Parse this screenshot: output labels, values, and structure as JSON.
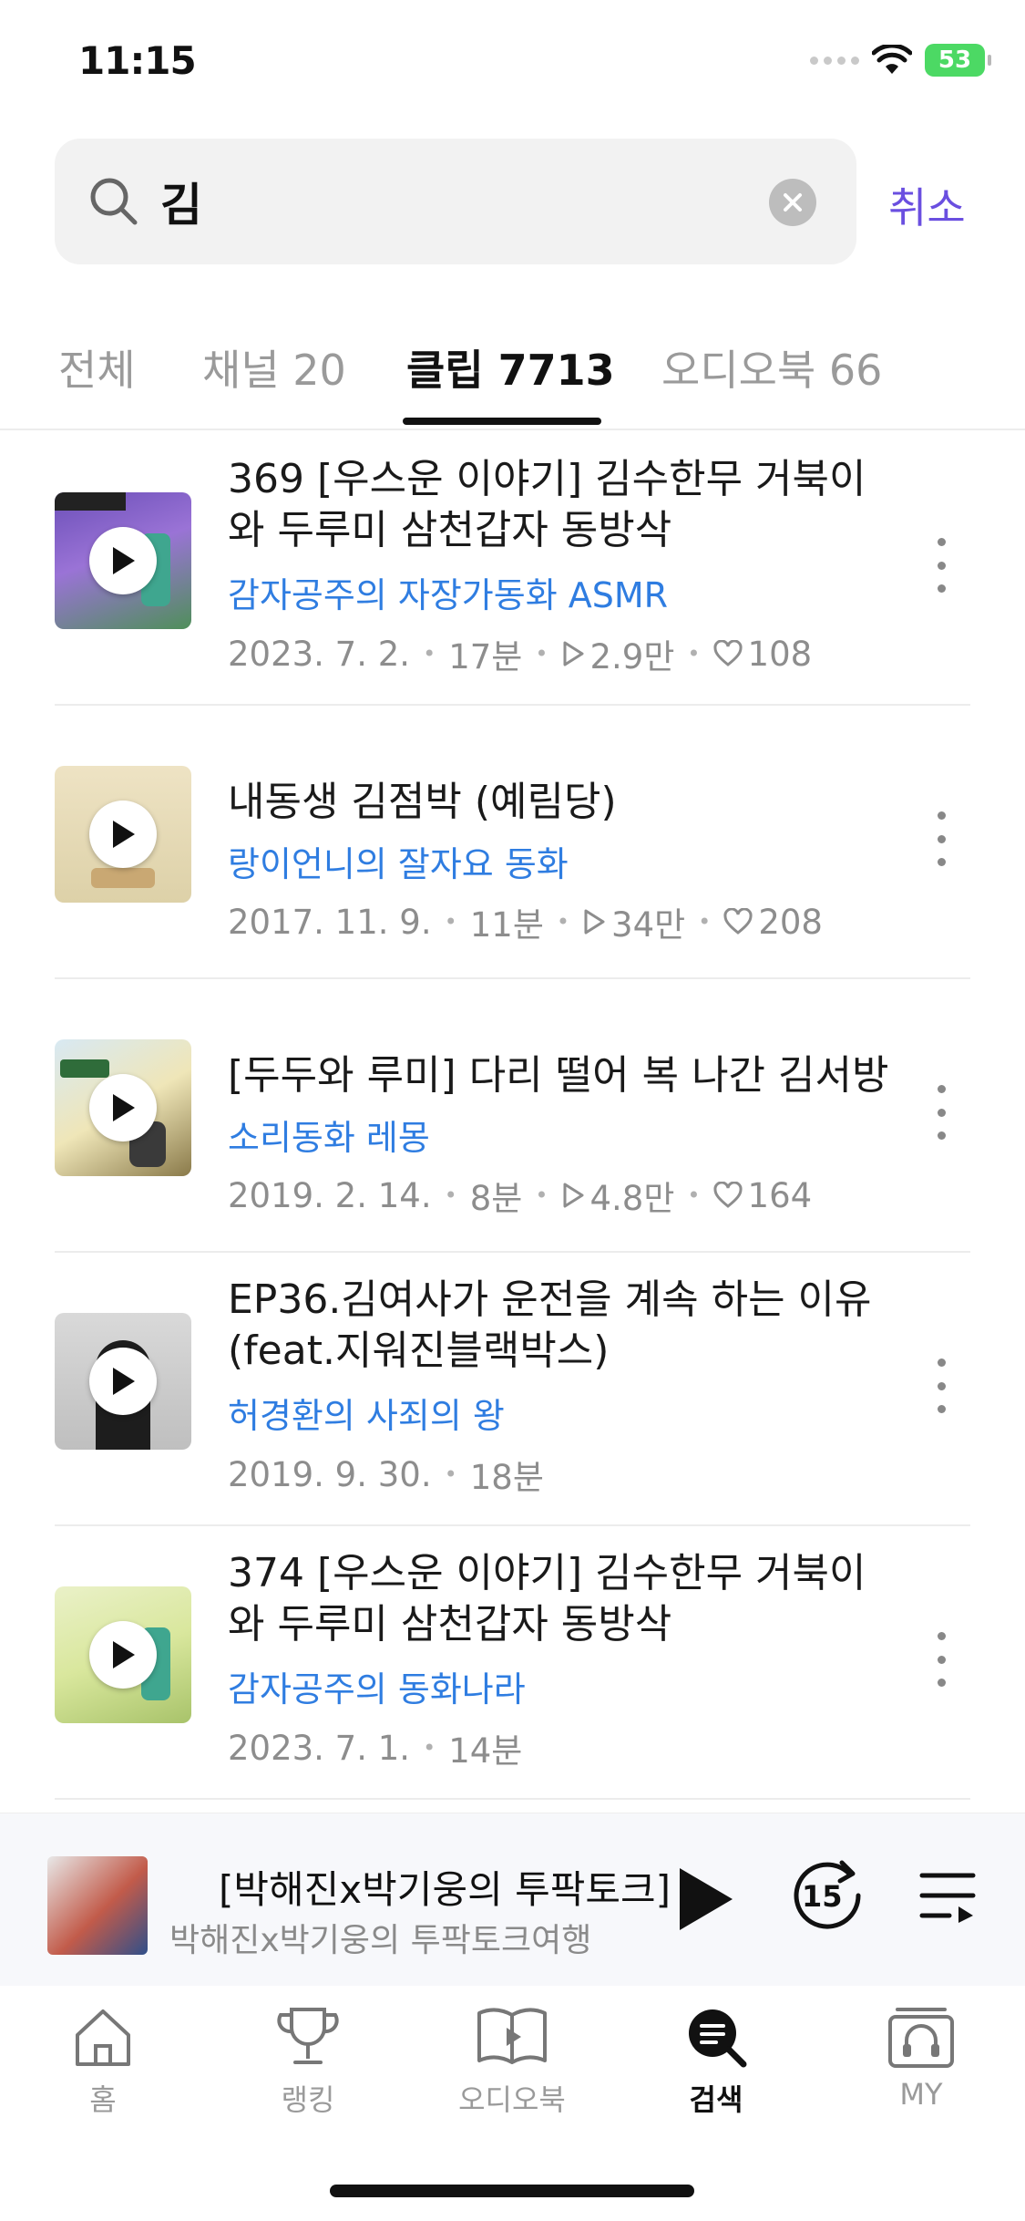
{
  "status_bar": {
    "time": "11:15",
    "battery": "53"
  },
  "search": {
    "query": "김",
    "cancel_label": "취소"
  },
  "tabs": [
    {
      "label": "전체"
    },
    {
      "label": "채널 20"
    },
    {
      "label": "클립 7713"
    },
    {
      "label": "오디오북 66"
    }
  ],
  "active_tab": "클립 7713",
  "clips": [
    {
      "title": "369 [우스운 이야기] 김수한무 거북이와 두루미 삼천갑자 동방삭",
      "channel": "감자공주의 자장가동화 ASMR",
      "date": "2023. 7. 2.",
      "duration": "17분",
      "plays": "2.9만",
      "likes": "108"
    },
    {
      "title": "내동생 김점박 (예림당)",
      "channel": "랑이언니의 잘자요 동화",
      "date": "2017. 11. 9.",
      "duration": "11분",
      "plays": "34만",
      "likes": "208"
    },
    {
      "title": "[두두와 루미] 다리 떨어 복 나간 김서방",
      "channel": "소리동화 레몽",
      "date": "2019. 2. 14.",
      "duration": "8분",
      "plays": "4.8만",
      "likes": "164"
    },
    {
      "title": "EP36.김여사가 운전을 계속 하는 이유 (feat.지워진블랙박스)",
      "channel": "허경환의 사죄의 왕",
      "date": "2019. 9. 30.",
      "duration": "18분"
    },
    {
      "title": "374 [우스운 이야기] 김수한무 거북이와 두루미 삼천갑자 동방삭",
      "channel": "감자공주의 동화나라",
      "date": "2023. 7. 1.",
      "duration": "14분"
    }
  ],
  "mini_player": {
    "title": "[박해진x박기웅의 투팍토크]",
    "subtitle": "박해진x박기웅의 투팍토크여행",
    "skip_label": "15"
  },
  "nav": [
    {
      "label": "홈",
      "icon": "home-icon"
    },
    {
      "label": "랭킹",
      "icon": "trophy-icon"
    },
    {
      "label": "오디오북",
      "icon": "book-icon"
    },
    {
      "label": "검색",
      "icon": "search-icon"
    },
    {
      "label": "MY",
      "icon": "headphones-icon"
    }
  ],
  "colors": {
    "accent": "#6a4fe0",
    "channel_link": "#2f7de1"
  }
}
